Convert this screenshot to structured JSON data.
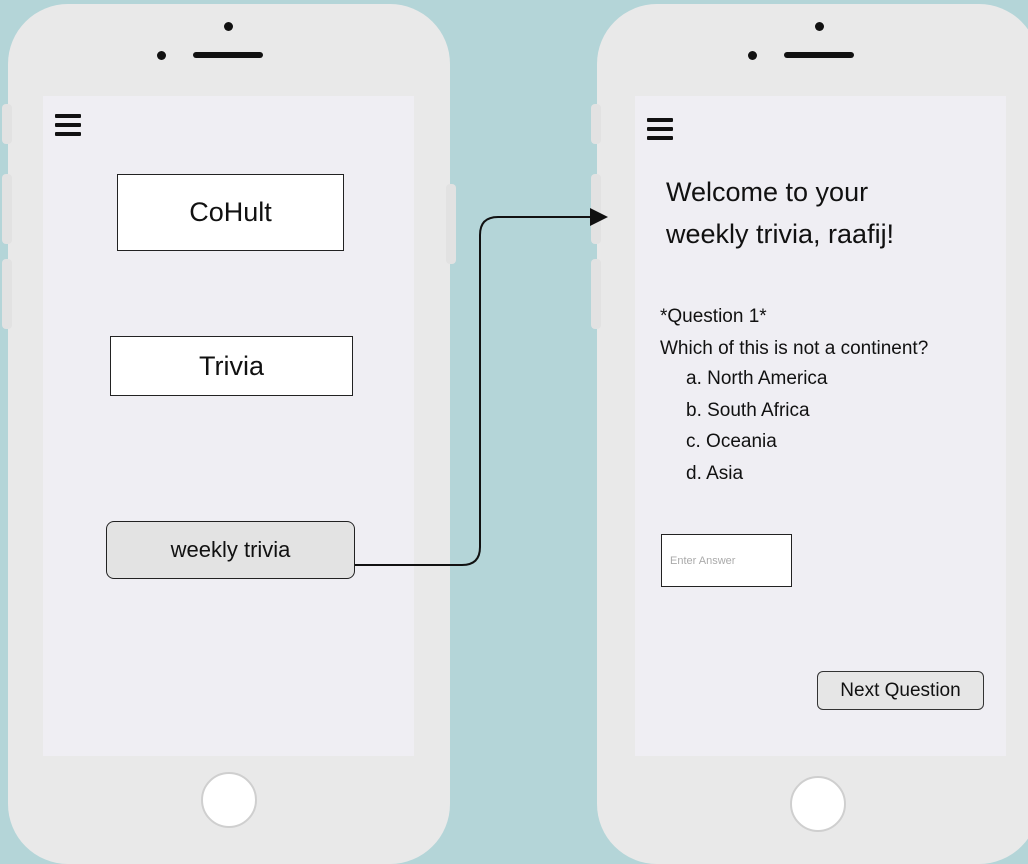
{
  "left_screen": {
    "title": "CoHult",
    "trivia_label": "Trivia",
    "weekly_trivia_label": "weekly trivia"
  },
  "right_screen": {
    "welcome_line1": "Welcome to your",
    "welcome_line2": "weekly trivia, raafij!",
    "question_label": "*Question 1*",
    "question_text": "Which of this is not a continent?",
    "options": [
      "a. North America",
      "b. South Africa",
      "c. Oceania",
      "d. Asia"
    ],
    "answer_placeholder": "Enter Answer",
    "next_button_label": "Next Question"
  },
  "icons": {
    "menu": "hamburger-menu-icon",
    "arrow": "flow-arrow"
  },
  "colors": {
    "background": "#b4d5d8",
    "phone_body": "#e9e9e9",
    "screen": "#efeef3",
    "button_fill": "#e3e3e3"
  }
}
